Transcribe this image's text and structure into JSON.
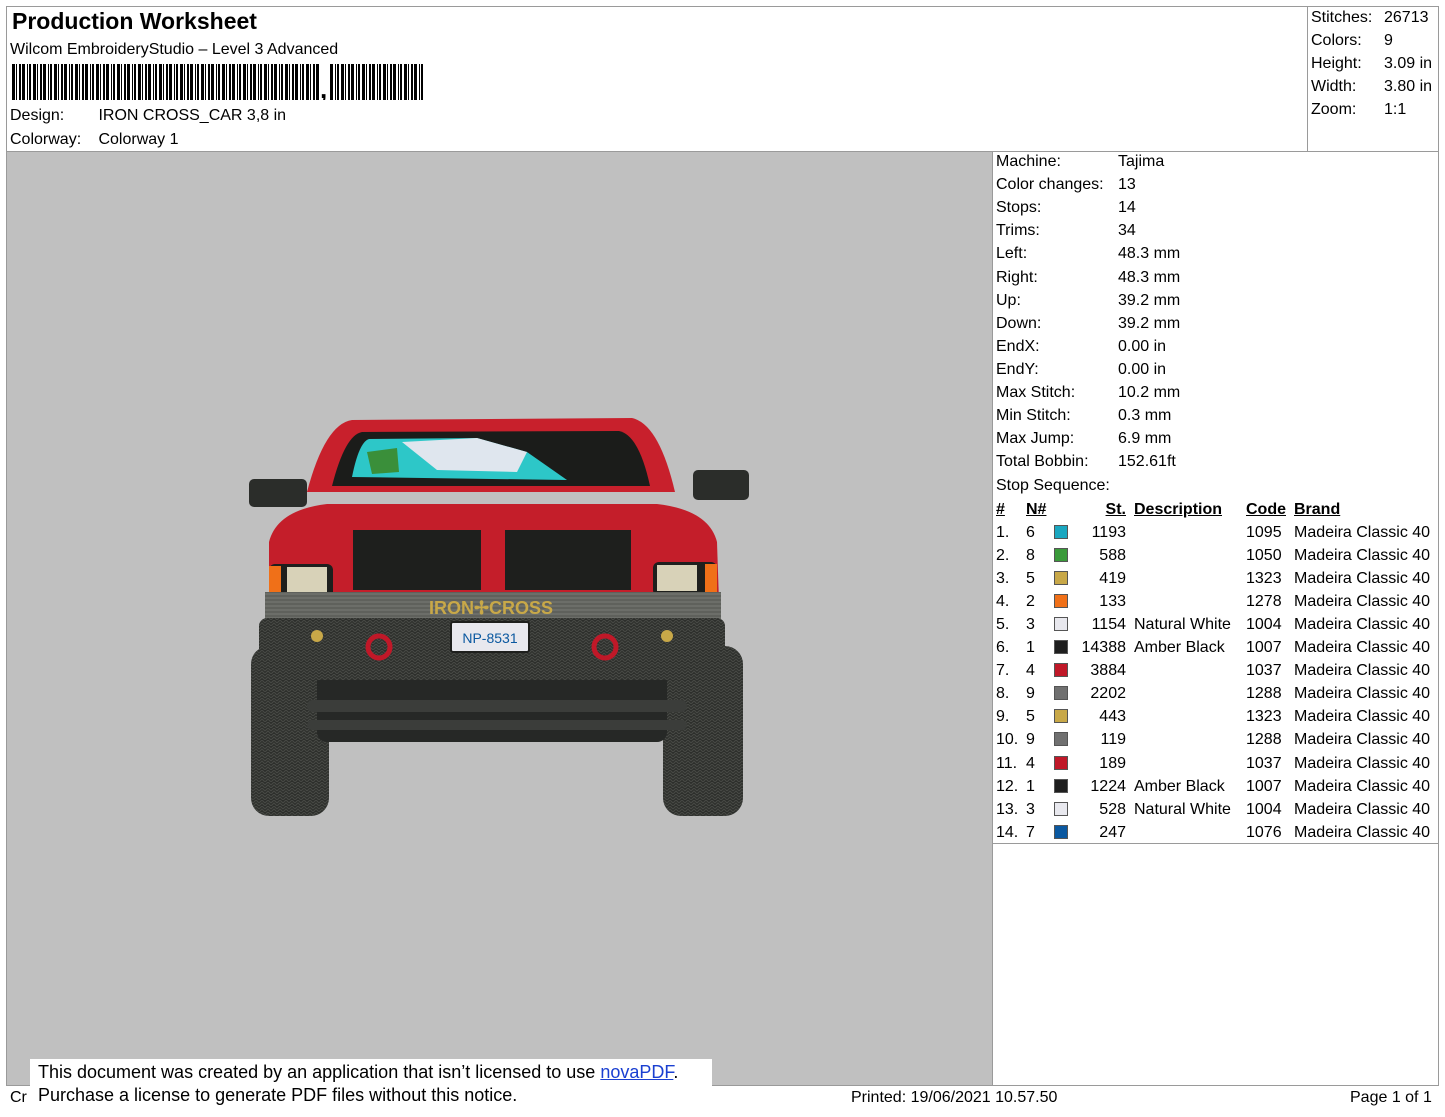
{
  "header": {
    "title": "Production Worksheet",
    "software": "Wilcom EmbroideryStudio – Level 3 Advanced",
    "design_label": "Design:",
    "design_value": "IRON CROSS_CAR 3,8 in",
    "colorway_label": "Colorway:",
    "colorway_value": "Colorway 1"
  },
  "stats": [
    {
      "label": "Stitches:",
      "value": "26713"
    },
    {
      "label": "Colors:",
      "value": "9"
    },
    {
      "label": "Height:",
      "value": "3.09 in"
    },
    {
      "label": "Width:",
      "value": "3.80 in"
    },
    {
      "label": "Zoom:",
      "value": "1:1"
    }
  ],
  "params": [
    {
      "label": "Machine:",
      "value": "Tajima"
    },
    {
      "label": "Color changes:",
      "value": "13"
    },
    {
      "label": "Stops:",
      "value": "14"
    },
    {
      "label": "Trims:",
      "value": "34"
    },
    {
      "label": "Left:",
      "value": "48.3 mm"
    },
    {
      "label": "Right:",
      "value": "48.3 mm"
    },
    {
      "label": "Up:",
      "value": "39.2 mm"
    },
    {
      "label": "Down:",
      "value": "39.2 mm"
    },
    {
      "label": "EndX:",
      "value": "0.00 in"
    },
    {
      "label": "EndY:",
      "value": "0.00 in"
    },
    {
      "label": "Max Stitch:",
      "value": "10.2 mm"
    },
    {
      "label": "Min Stitch:",
      "value": "0.3 mm"
    },
    {
      "label": "Max Jump:",
      "value": "6.9 mm"
    },
    {
      "label": "Total Bobbin:",
      "value": "152.61ft"
    }
  ],
  "stop_sequence": {
    "label": "Stop Sequence:",
    "headers": {
      "num": "#",
      "needle": "N#",
      "stitches": "St.",
      "description": "Description",
      "code": "Code",
      "brand": "Brand"
    },
    "rows": [
      {
        "num": "1.",
        "needle": "6",
        "color": "#1aa7c0",
        "stitches": "1193",
        "description": "",
        "code": "1095",
        "brand": "Madeira Classic 40"
      },
      {
        "num": "2.",
        "needle": "8",
        "color": "#3a9a3a",
        "stitches": "588",
        "description": "",
        "code": "1050",
        "brand": "Madeira Classic 40"
      },
      {
        "num": "3.",
        "needle": "5",
        "color": "#c8a848",
        "stitches": "419",
        "description": "",
        "code": "1323",
        "brand": "Madeira Classic 40"
      },
      {
        "num": "4.",
        "needle": "2",
        "color": "#f07018",
        "stitches": "133",
        "description": "",
        "code": "1278",
        "brand": "Madeira Classic 40"
      },
      {
        "num": "5.",
        "needle": "3",
        "color": "#e8e8ee",
        "stitches": "1154",
        "description": "Natural White",
        "code": "1004",
        "brand": "Madeira Classic 40"
      },
      {
        "num": "6.",
        "needle": "1",
        "color": "#1e1e1e",
        "stitches": "14388",
        "description": "Amber Black",
        "code": "1007",
        "brand": "Madeira Classic 40"
      },
      {
        "num": "7.",
        "needle": "4",
        "color": "#c01828",
        "stitches": "3884",
        "description": "",
        "code": "1037",
        "brand": "Madeira Classic 40"
      },
      {
        "num": "8.",
        "needle": "9",
        "color": "#707070",
        "stitches": "2202",
        "description": "",
        "code": "1288",
        "brand": "Madeira Classic 40"
      },
      {
        "num": "9.",
        "needle": "5",
        "color": "#c8a848",
        "stitches": "443",
        "description": "",
        "code": "1323",
        "brand": "Madeira Classic 40"
      },
      {
        "num": "10.",
        "needle": "9",
        "color": "#707070",
        "stitches": "119",
        "description": "",
        "code": "1288",
        "brand": "Madeira Classic 40"
      },
      {
        "num": "11.",
        "needle": "4",
        "color": "#c01828",
        "stitches": "189",
        "description": "",
        "code": "1037",
        "brand": "Madeira Classic 40"
      },
      {
        "num": "12.",
        "needle": "1",
        "color": "#1e1e1e",
        "stitches": "1224",
        "description": "Amber Black",
        "code": "1007",
        "brand": "Madeira Classic 40"
      },
      {
        "num": "13.",
        "needle": "3",
        "color": "#e8e8ee",
        "stitches": "528",
        "description": "Natural White",
        "code": "1004",
        "brand": "Madeira Classic 40"
      },
      {
        "num": "14.",
        "needle": "7",
        "color": "#0a58a0",
        "stitches": "247",
        "description": "",
        "code": "1076",
        "brand": "Madeira Classic 40"
      }
    ]
  },
  "design_preview": {
    "bumper_text": "IRON✢CROSS",
    "plate_text": "NP-8531"
  },
  "footer": {
    "left_stub": "Cr",
    "printed": "Printed: 19/06/2021 10.57.50",
    "page": "Page 1 of 1",
    "notice_line1_prefix": "This document was created by an application that isn’t licensed to use ",
    "notice_link": "novaPDF",
    "notice_line1_suffix": ".",
    "notice_line2": "Purchase a license to generate PDF files without this notice."
  }
}
